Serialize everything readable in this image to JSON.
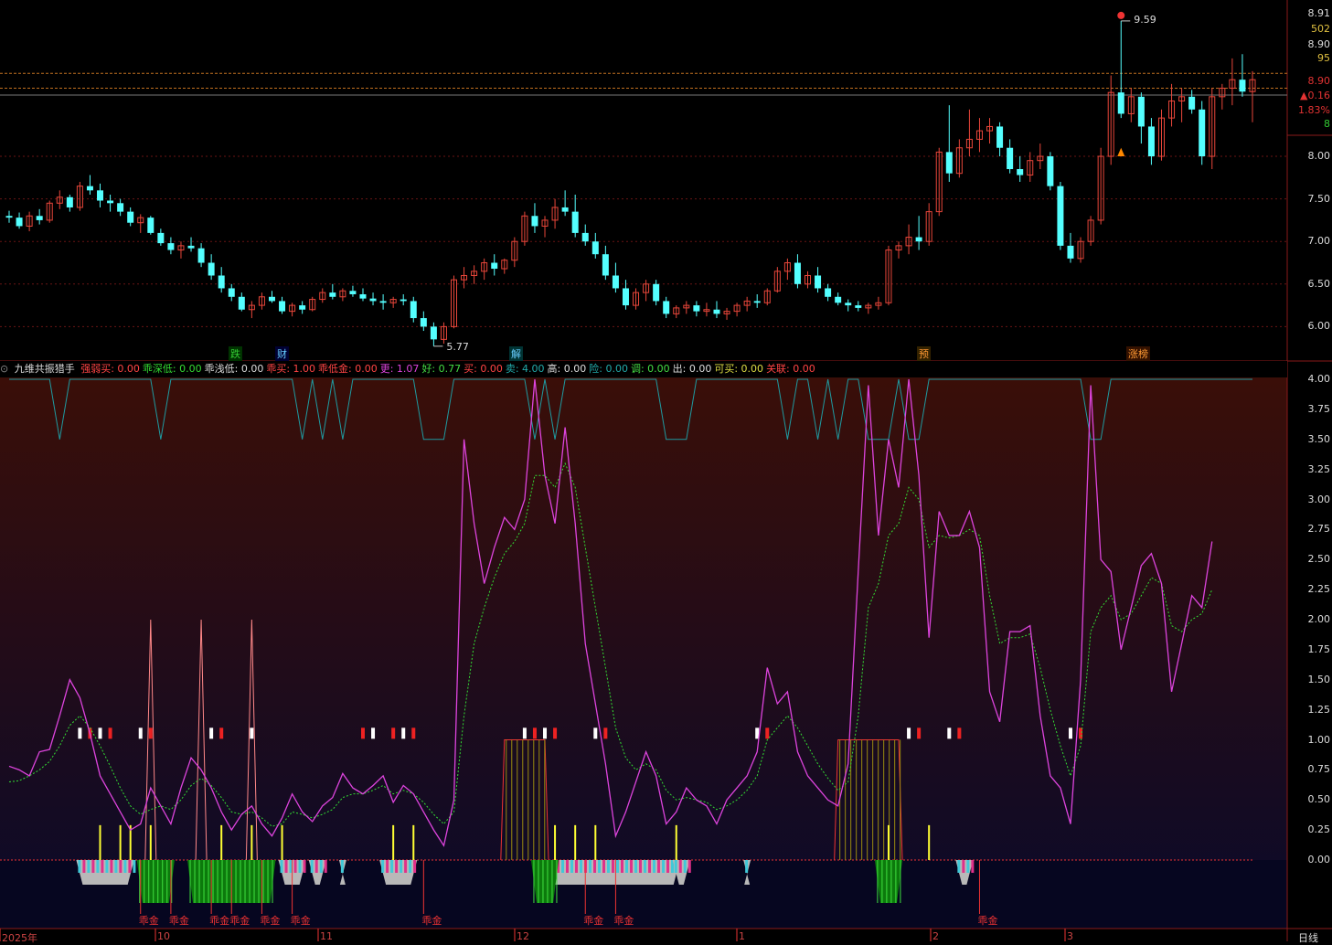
{
  "price_panel": {
    "y_ticks": [
      "8.00",
      "7.50",
      "7.00",
      "6.50",
      "6.00"
    ],
    "right_labels": [
      {
        "text": "8.91",
        "color": "#dddddd"
      },
      {
        "text": "502",
        "color": "#e0c040"
      },
      {
        "text": "8.90",
        "color": "#dddddd"
      },
      {
        "text": "95",
        "color": "#e0c040"
      },
      {
        "text": "8.90",
        "color": "#e33333"
      },
      {
        "text": "▲0.16",
        "color": "#e33333"
      },
      {
        "text": "1.83%",
        "color": "#e33333"
      },
      {
        "text": "8",
        "color": "#33cc33"
      }
    ],
    "high_label": "9.59",
    "low_label": "5.77",
    "event_tags": [
      {
        "text": "跌",
        "color": "#33cc33",
        "bg": "#003300"
      },
      {
        "text": "财",
        "color": "#66ccff",
        "bg": "#000033"
      },
      {
        "text": "解",
        "color": "#66ccff",
        "bg": "#003333"
      },
      {
        "text": "预",
        "color": "#ff9933",
        "bg": "#332200"
      },
      {
        "text": "涨榜",
        "color": "#ff9933",
        "bg": "#331100"
      }
    ]
  },
  "indicator_header": {
    "name": "九维共振猎手",
    "items": [
      {
        "label": "强弱买: 0.00",
        "color": "#ff4444"
      },
      {
        "label": "乖深低: 0.00",
        "color": "#33dd33"
      },
      {
        "label": "乖浅低: 0.00",
        "color": "#dddddd"
      },
      {
        "label": "乖买: 1.00",
        "color": "#ff4444"
      },
      {
        "label": "乖低金: 0.00",
        "color": "#ff4444"
      },
      {
        "label": "更: 1.07",
        "color": "#dd44dd"
      },
      {
        "label": "好: 0.77",
        "color": "#44dd44"
      },
      {
        "label": "买: 0.00",
        "color": "#ff4444"
      },
      {
        "label": "卖: 4.00",
        "color": "#22aaaa"
      },
      {
        "label": "高: 0.00",
        "color": "#dddddd"
      },
      {
        "label": "险: 0.00",
        "color": "#22aaaa"
      },
      {
        "label": "调: 0.00",
        "color": "#44dd44"
      },
      {
        "label": "出: 0.00",
        "color": "#dddddd"
      },
      {
        "label": "可买: 0.00",
        "color": "#dddd44"
      },
      {
        "label": "关联: 0.00",
        "color": "#ff4444"
      }
    ]
  },
  "indicator_panel": {
    "y_ticks": [
      "4.00",
      "3.75",
      "3.50",
      "3.25",
      "3.00",
      "2.75",
      "2.50",
      "2.25",
      "2.00",
      "1.75",
      "1.50",
      "1.25",
      "1.00",
      "0.75",
      "0.50",
      "0.25",
      "0.00"
    ],
    "signal_label": "乖金"
  },
  "x_axis": {
    "labels": [
      "2025年",
      "10",
      "11",
      "12",
      "1",
      "2",
      "3"
    ],
    "period": "日线"
  },
  "chart_data": {
    "type": "candlestick",
    "ylim": [
      5.65,
      9.75
    ],
    "candles": [
      [
        7.3,
        7.36,
        7.22,
        7.28
      ],
      [
        7.28,
        7.34,
        7.15,
        7.18
      ],
      [
        7.18,
        7.35,
        7.12,
        7.3
      ],
      [
        7.3,
        7.38,
        7.2,
        7.25
      ],
      [
        7.25,
        7.48,
        7.22,
        7.45
      ],
      [
        7.45,
        7.6,
        7.38,
        7.52
      ],
      [
        7.52,
        7.55,
        7.35,
        7.4
      ],
      [
        7.4,
        7.7,
        7.36,
        7.65
      ],
      [
        7.65,
        7.78,
        7.55,
        7.6
      ],
      [
        7.6,
        7.68,
        7.4,
        7.48
      ],
      [
        7.48,
        7.55,
        7.35,
        7.45
      ],
      [
        7.45,
        7.5,
        7.3,
        7.35
      ],
      [
        7.35,
        7.4,
        7.18,
        7.22
      ],
      [
        7.22,
        7.32,
        7.1,
        7.28
      ],
      [
        7.28,
        7.3,
        7.08,
        7.1
      ],
      [
        7.1,
        7.15,
        6.95,
        6.98
      ],
      [
        6.98,
        7.05,
        6.85,
        6.9
      ],
      [
        6.9,
        7.0,
        6.8,
        6.95
      ],
      [
        6.95,
        7.05,
        6.88,
        6.92
      ],
      [
        6.92,
        6.98,
        6.7,
        6.75
      ],
      [
        6.75,
        6.85,
        6.55,
        6.6
      ],
      [
        6.6,
        6.7,
        6.4,
        6.45
      ],
      [
        6.45,
        6.5,
        6.3,
        6.35
      ],
      [
        6.35,
        6.4,
        6.18,
        6.2
      ],
      [
        6.2,
        6.3,
        6.1,
        6.25
      ],
      [
        6.25,
        6.4,
        6.2,
        6.35
      ],
      [
        6.35,
        6.42,
        6.28,
        6.3
      ],
      [
        6.3,
        6.35,
        6.15,
        6.18
      ],
      [
        6.18,
        6.28,
        6.12,
        6.25
      ],
      [
        6.25,
        6.3,
        6.15,
        6.2
      ],
      [
        6.2,
        6.35,
        6.18,
        6.32
      ],
      [
        6.32,
        6.45,
        6.28,
        6.4
      ],
      [
        6.4,
        6.5,
        6.32,
        6.35
      ],
      [
        6.35,
        6.45,
        6.3,
        6.42
      ],
      [
        6.42,
        6.48,
        6.35,
        6.38
      ],
      [
        6.38,
        6.45,
        6.3,
        6.33
      ],
      [
        6.33,
        6.4,
        6.25,
        6.3
      ],
      [
        6.3,
        6.38,
        6.2,
        6.28
      ],
      [
        6.28,
        6.35,
        6.22,
        6.32
      ],
      [
        6.32,
        6.38,
        6.25,
        6.3
      ],
      [
        6.3,
        6.35,
        6.05,
        6.1
      ],
      [
        6.1,
        6.18,
        5.95,
        6.0
      ],
      [
        6.0,
        6.05,
        5.77,
        5.85
      ],
      [
        5.85,
        6.05,
        5.8,
        6.0
      ],
      [
        6.0,
        6.6,
        5.98,
        6.55
      ],
      [
        6.55,
        6.7,
        6.45,
        6.6
      ],
      [
        6.6,
        6.72,
        6.5,
        6.65
      ],
      [
        6.65,
        6.8,
        6.55,
        6.75
      ],
      [
        6.75,
        6.85,
        6.6,
        6.68
      ],
      [
        6.68,
        6.8,
        6.62,
        6.78
      ],
      [
        6.78,
        7.05,
        6.7,
        7.0
      ],
      [
        7.0,
        7.35,
        6.95,
        7.3
      ],
      [
        7.3,
        7.45,
        7.1,
        7.18
      ],
      [
        7.18,
        7.3,
        7.05,
        7.25
      ],
      [
        7.25,
        7.5,
        7.15,
        7.4
      ],
      [
        7.4,
        7.6,
        7.3,
        7.35
      ],
      [
        7.35,
        7.55,
        7.05,
        7.1
      ],
      [
        7.1,
        7.2,
        6.95,
        7.0
      ],
      [
        7.0,
        7.1,
        6.8,
        6.85
      ],
      [
        6.85,
        6.95,
        6.55,
        6.6
      ],
      [
        6.6,
        6.75,
        6.4,
        6.45
      ],
      [
        6.45,
        6.55,
        6.2,
        6.25
      ],
      [
        6.25,
        6.45,
        6.2,
        6.4
      ],
      [
        6.4,
        6.55,
        6.3,
        6.5
      ],
      [
        6.5,
        6.55,
        6.25,
        6.3
      ],
      [
        6.3,
        6.35,
        6.1,
        6.15
      ],
      [
        6.15,
        6.25,
        6.1,
        6.22
      ],
      [
        6.22,
        6.3,
        6.15,
        6.25
      ],
      [
        6.25,
        6.3,
        6.12,
        6.18
      ],
      [
        6.18,
        6.28,
        6.12,
        6.2
      ],
      [
        6.2,
        6.3,
        6.1,
        6.15
      ],
      [
        6.15,
        6.22,
        6.08,
        6.18
      ],
      [
        6.18,
        6.28,
        6.12,
        6.25
      ],
      [
        6.25,
        6.35,
        6.18,
        6.3
      ],
      [
        6.3,
        6.38,
        6.22,
        6.28
      ],
      [
        6.28,
        6.45,
        6.25,
        6.42
      ],
      [
        6.42,
        6.7,
        6.4,
        6.65
      ],
      [
        6.65,
        6.8,
        6.55,
        6.75
      ],
      [
        6.75,
        6.85,
        6.45,
        6.5
      ],
      [
        6.5,
        6.65,
        6.45,
        6.6
      ],
      [
        6.6,
        6.7,
        6.4,
        6.45
      ],
      [
        6.45,
        6.5,
        6.3,
        6.35
      ],
      [
        6.35,
        6.4,
        6.25,
        6.28
      ],
      [
        6.28,
        6.32,
        6.18,
        6.25
      ],
      [
        6.25,
        6.3,
        6.18,
        6.22
      ],
      [
        6.22,
        6.28,
        6.15,
        6.25
      ],
      [
        6.25,
        6.35,
        6.2,
        6.28
      ],
      [
        6.28,
        6.95,
        6.25,
        6.9
      ],
      [
        6.9,
        7.0,
        6.8,
        6.95
      ],
      [
        6.95,
        7.2,
        6.85,
        7.05
      ],
      [
        7.05,
        7.3,
        6.9,
        7.0
      ],
      [
        7.0,
        7.45,
        6.95,
        7.35
      ],
      [
        7.35,
        8.1,
        7.3,
        8.05
      ],
      [
        8.05,
        8.6,
        7.7,
        7.8
      ],
      [
        7.8,
        8.2,
        7.75,
        8.1
      ],
      [
        8.1,
        8.55,
        8.0,
        8.2
      ],
      [
        8.2,
        8.45,
        8.05,
        8.3
      ],
      [
        8.3,
        8.45,
        8.15,
        8.35
      ],
      [
        8.35,
        8.4,
        8.0,
        8.1
      ],
      [
        8.1,
        8.2,
        7.8,
        7.85
      ],
      [
        7.85,
        8.0,
        7.7,
        7.78
      ],
      [
        7.78,
        8.05,
        7.7,
        7.95
      ],
      [
        7.95,
        8.15,
        7.85,
        8.0
      ],
      [
        8.0,
        8.05,
        7.6,
        7.65
      ],
      [
        7.65,
        7.7,
        6.9,
        6.95
      ],
      [
        6.95,
        7.1,
        6.75,
        6.8
      ],
      [
        6.8,
        7.05,
        6.75,
        7.0
      ],
      [
        7.0,
        7.3,
        6.95,
        7.25
      ],
      [
        7.25,
        8.1,
        7.2,
        8.0
      ],
      [
        8.0,
        8.95,
        7.9,
        8.75
      ],
      [
        8.75,
        9.59,
        8.45,
        8.5
      ],
      [
        8.5,
        8.8,
        8.4,
        8.7
      ],
      [
        8.7,
        8.75,
        8.15,
        8.35
      ],
      [
        8.35,
        8.45,
        7.9,
        8.0
      ],
      [
        8.0,
        8.55,
        7.95,
        8.45
      ],
      [
        8.45,
        8.85,
        8.35,
        8.65
      ],
      [
        8.65,
        8.8,
        8.4,
        8.7
      ],
      [
        8.7,
        8.78,
        8.5,
        8.55
      ],
      [
        8.55,
        8.65,
        7.9,
        8.0
      ],
      [
        8.0,
        8.8,
        7.85,
        8.7
      ],
      [
        8.7,
        8.85,
        8.55,
        8.8
      ],
      [
        8.8,
        9.15,
        8.6,
        8.9
      ],
      [
        8.9,
        9.2,
        8.7,
        8.76
      ],
      [
        8.76,
        9.0,
        8.4,
        8.9
      ]
    ],
    "osc_line": [
      0.78,
      0.75,
      0.7,
      0.9,
      0.92,
      1.2,
      1.5,
      1.35,
      1.05,
      0.7,
      0.55,
      0.4,
      0.25,
      0.3,
      0.6,
      0.45,
      0.3,
      0.6,
      0.85,
      0.75,
      0.6,
      0.4,
      0.25,
      0.38,
      0.45,
      0.3,
      0.2,
      0.35,
      0.55,
      0.4,
      0.32,
      0.45,
      0.52,
      0.72,
      0.6,
      0.55,
      0.62,
      0.7,
      0.48,
      0.62,
      0.55,
      0.4,
      0.25,
      0.12,
      0.5,
      3.5,
      2.8,
      2.3,
      2.6,
      2.85,
      2.75,
      3.0,
      4.0,
      3.2,
      2.8,
      3.6,
      2.8,
      1.8,
      1.3,
      0.8,
      0.2,
      0.4,
      0.65,
      0.9,
      0.7,
      0.3,
      0.4,
      0.6,
      0.5,
      0.45,
      0.3,
      0.5,
      0.6,
      0.7,
      0.9,
      1.6,
      1.3,
      1.4,
      0.9,
      0.7,
      0.6,
      0.5,
      0.45,
      0.8,
      2.4,
      3.95,
      2.7,
      3.5,
      3.1,
      4.0,
      3.2,
      1.85,
      2.9,
      2.7,
      2.7,
      2.9,
      2.6,
      1.4,
      1.15,
      1.9,
      1.9,
      1.95,
      1.2,
      0.7,
      0.6,
      0.3,
      1.5,
      3.95,
      2.5,
      2.4,
      1.75,
      2.1,
      2.45,
      2.55,
      2.3,
      1.4,
      1.8,
      2.2,
      2.1,
      2.65
    ],
    "osc_avg": [
      0.65,
      0.66,
      0.7,
      0.75,
      0.82,
      0.95,
      1.12,
      1.2,
      1.1,
      0.95,
      0.78,
      0.6,
      0.45,
      0.38,
      0.42,
      0.45,
      0.42,
      0.5,
      0.62,
      0.68,
      0.62,
      0.52,
      0.4,
      0.38,
      0.4,
      0.35,
      0.28,
      0.3,
      0.4,
      0.38,
      0.35,
      0.38,
      0.42,
      0.52,
      0.55,
      0.55,
      0.58,
      0.62,
      0.55,
      0.58,
      0.55,
      0.48,
      0.38,
      0.3,
      0.4,
      1.2,
      1.8,
      2.1,
      2.35,
      2.55,
      2.65,
      2.8,
      3.2,
      3.2,
      3.1,
      3.3,
      3.1,
      2.6,
      2.1,
      1.6,
      1.1,
      0.85,
      0.75,
      0.8,
      0.75,
      0.58,
      0.5,
      0.52,
      0.5,
      0.48,
      0.42,
      0.45,
      0.5,
      0.58,
      0.7,
      1.0,
      1.1,
      1.2,
      1.1,
      0.95,
      0.8,
      0.68,
      0.58,
      0.65,
      1.2,
      2.1,
      2.3,
      2.7,
      2.8,
      3.1,
      3.0,
      2.6,
      2.7,
      2.68,
      2.7,
      2.75,
      2.7,
      2.2,
      1.8,
      1.85,
      1.85,
      1.88,
      1.6,
      1.25,
      0.95,
      0.7,
      0.95,
      1.9,
      2.1,
      2.2,
      2.0,
      2.05,
      2.2,
      2.35,
      2.3,
      1.95,
      1.9,
      2.0,
      2.05,
      2.25
    ]
  }
}
